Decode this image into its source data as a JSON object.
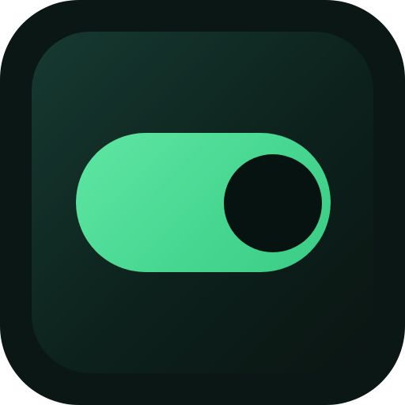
{
  "icon": {
    "name": "toggle-switch-icon",
    "frame_color": "#0a1714",
    "face_color_start": "#163a31",
    "face_color_end": "#0b1512"
  },
  "toggle": {
    "state": "on",
    "track_color": "#4fdc98",
    "knob_color": "#071310"
  }
}
